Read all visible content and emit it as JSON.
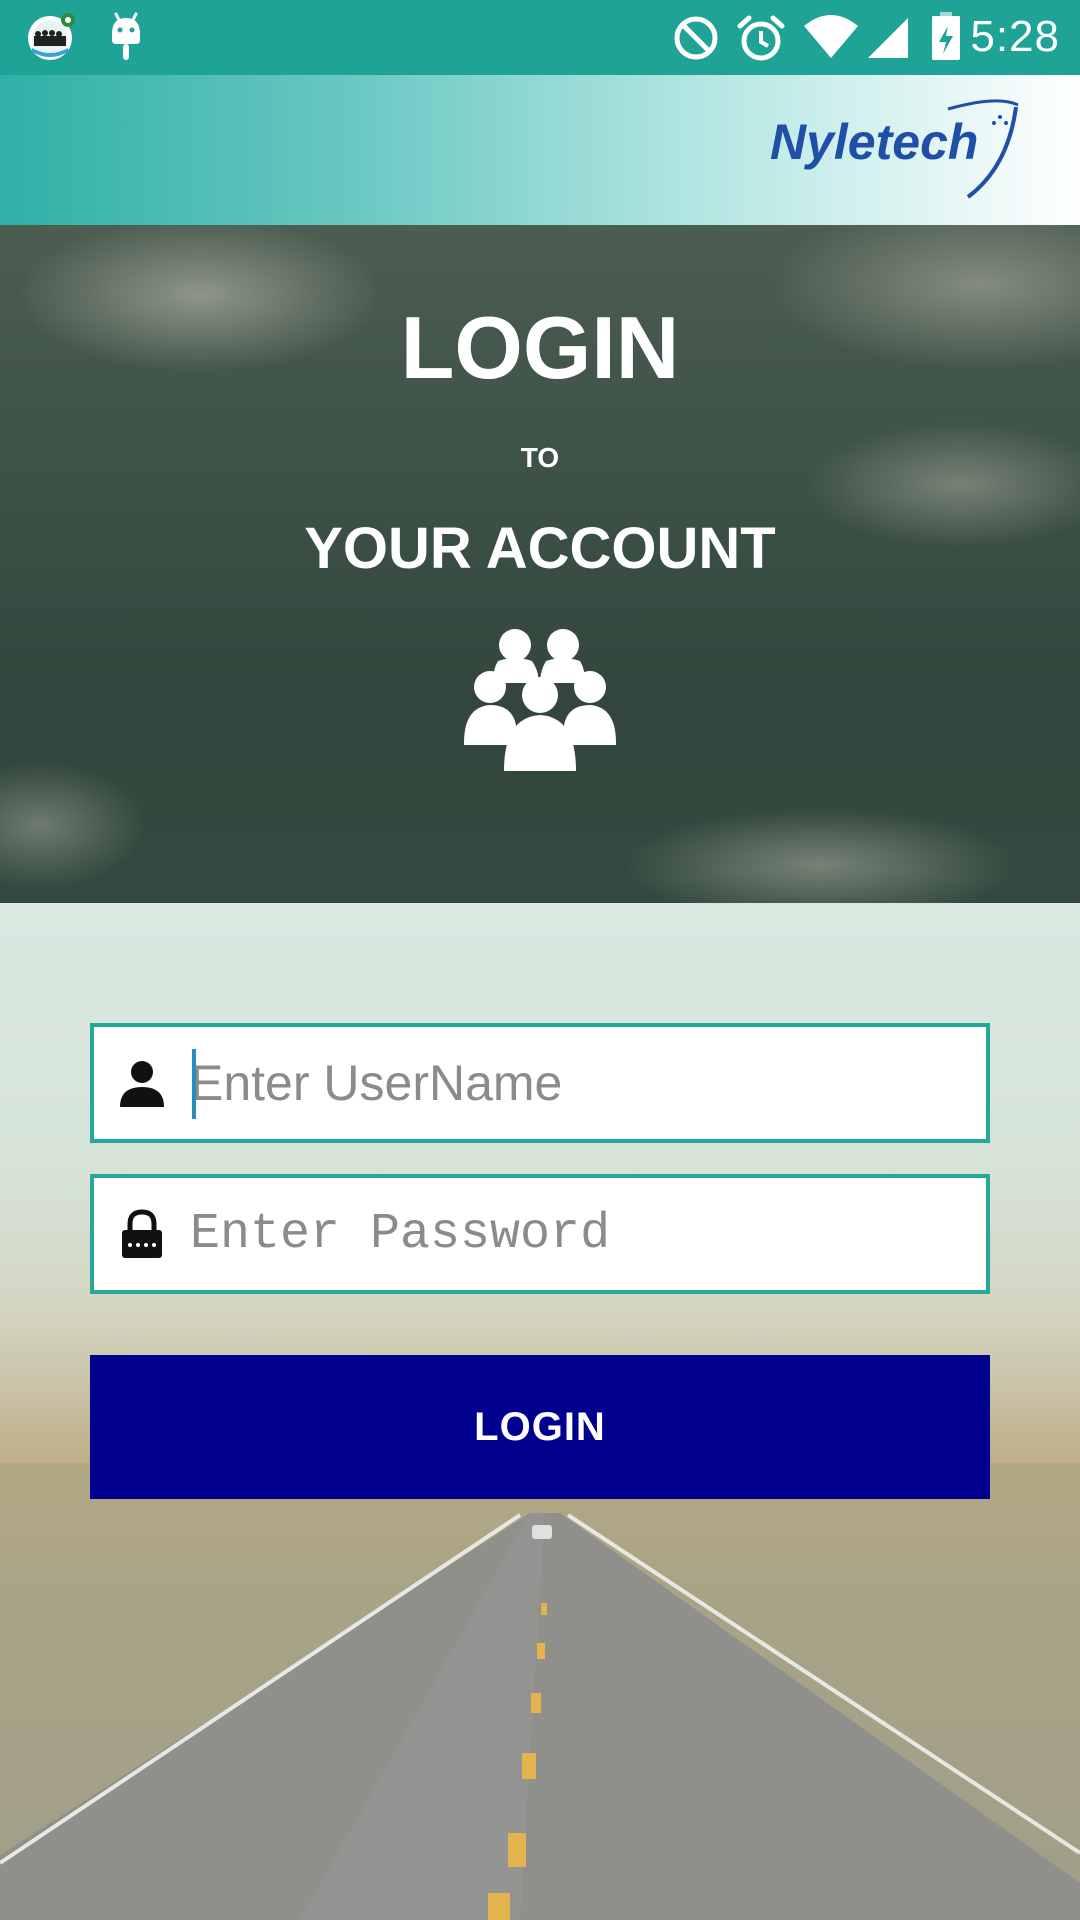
{
  "status_bar": {
    "time": "5:28",
    "icons": [
      "app-notification-icon",
      "android-icon",
      "do-not-disturb-icon",
      "alarm-icon",
      "wifi-icon",
      "cell-signal-icon",
      "battery-charging-icon"
    ]
  },
  "header": {
    "logo_text": "Nyletech"
  },
  "hero": {
    "title": "LOGIN",
    "connector": "TO",
    "subtitle": "YOUR ACCOUNT",
    "icon": "group-icon"
  },
  "form": {
    "username": {
      "placeholder": "Enter UserName",
      "value": "",
      "icon": "user-icon"
    },
    "password": {
      "placeholder": "Enter Password",
      "value": "",
      "icon": "lock-icon"
    },
    "submit_label": "LOGIN"
  },
  "colors": {
    "status_bar": "#1fa396",
    "field_border": "#27a69a",
    "button": "#01008e",
    "logo": "#1f4fa8"
  }
}
